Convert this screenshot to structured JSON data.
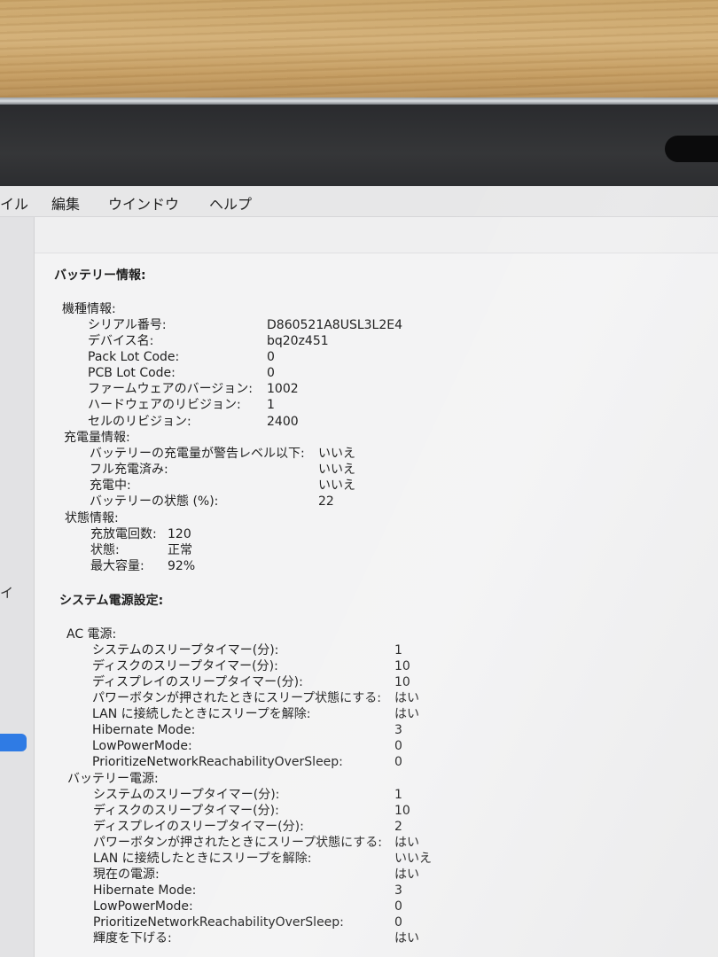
{
  "menubar": {
    "items": [
      "イル",
      "編集",
      "ウインドウ",
      "ヘルプ"
    ]
  },
  "sidebar": {
    "partial_char": "イ"
  },
  "battery": {
    "title": "バッテリー情報:",
    "model": {
      "heading": "機種情報:",
      "rows": [
        {
          "label": "シリアル番号:",
          "value": "D860521A8USL3L2E4"
        },
        {
          "label": "デバイス名:",
          "value": "bq20z451"
        },
        {
          "label": "Pack Lot Code:",
          "value": "0"
        },
        {
          "label": "PCB Lot Code:",
          "value": "0"
        },
        {
          "label": "ファームウェアのバージョン:",
          "value": "1002"
        },
        {
          "label": "ハードウェアのリビジョン:",
          "value": "1"
        },
        {
          "label": "セルのリビジョン:",
          "value": "2400"
        }
      ]
    },
    "charge": {
      "heading": "充電量情報:",
      "rows": [
        {
          "label": "バッテリーの充電量が警告レベル以下:",
          "value": "いいえ"
        },
        {
          "label": "フル充電済み:",
          "value": "いいえ"
        },
        {
          "label": "充電中:",
          "value": "いいえ"
        },
        {
          "label": "バッテリーの状態 (%):",
          "value": "22"
        }
      ]
    },
    "status": {
      "heading": "状態情報:",
      "rows": [
        {
          "label": "充放電回数:",
          "value": "120"
        },
        {
          "label": "状態:",
          "value": "正常"
        },
        {
          "label": "最大容量:",
          "value": "92%"
        }
      ]
    }
  },
  "power": {
    "title": "システム電源設定:",
    "ac": {
      "heading": "AC 電源:",
      "rows": [
        {
          "label": "システムのスリープタイマー(分):",
          "value": "1"
        },
        {
          "label": "ディスクのスリープタイマー(分):",
          "value": "10"
        },
        {
          "label": "ディスプレイのスリープタイマー(分):",
          "value": "10"
        },
        {
          "label": "パワーボタンが押されたときにスリープ状態にする:",
          "value": "はい"
        },
        {
          "label": "LAN に接続したときにスリープを解除:",
          "value": "はい"
        },
        {
          "label": "Hibernate Mode:",
          "value": "3"
        },
        {
          "label": "LowPowerMode:",
          "value": "0"
        },
        {
          "label": "PrioritizeNetworkReachabilityOverSleep:",
          "value": "0"
        }
      ]
    },
    "battery_power": {
      "heading": "バッテリー電源:",
      "rows": [
        {
          "label": "システムのスリープタイマー(分):",
          "value": "1"
        },
        {
          "label": "ディスクのスリープタイマー(分):",
          "value": "10"
        },
        {
          "label": "ディスプレイのスリープタイマー(分):",
          "value": "2"
        },
        {
          "label": "パワーボタンが押されたときにスリープ状態にする:",
          "value": "はい"
        },
        {
          "label": "LAN に接続したときにスリープを解除:",
          "value": "いいえ"
        },
        {
          "label": "現在の電源:",
          "value": "はい"
        },
        {
          "label": "Hibernate Mode:",
          "value": "3"
        },
        {
          "label": "LowPowerMode:",
          "value": "0"
        },
        {
          "label": "PrioritizeNetworkReachabilityOverSleep:",
          "value": "0"
        },
        {
          "label": "輝度を下げる:",
          "value": "はい"
        }
      ]
    }
  }
}
